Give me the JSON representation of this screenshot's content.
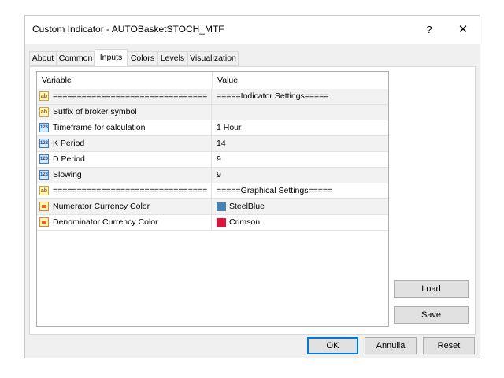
{
  "window": {
    "title": "Custom Indicator - AUTOBasketSTOCH_MTF",
    "help_label": "?",
    "close_label": "✕"
  },
  "tabs": [
    {
      "label": "About",
      "active": false
    },
    {
      "label": "Common",
      "active": false
    },
    {
      "label": "Inputs",
      "active": true
    },
    {
      "label": "Colors",
      "active": false
    },
    {
      "label": "Levels",
      "active": false
    },
    {
      "label": "Visualization",
      "active": false
    }
  ],
  "grid": {
    "headers": {
      "variable": "Variable",
      "value": "Value"
    },
    "rows": [
      {
        "icon": "string-icon",
        "variable": "================================",
        "value": "=====Indicator Settings====="
      },
      {
        "icon": "string-icon",
        "variable": "Suffix of broker symbol",
        "value": ""
      },
      {
        "icon": "integer-icon",
        "variable": "Timeframe for calculation",
        "value": "1 Hour"
      },
      {
        "icon": "integer-icon",
        "variable": "K Period",
        "value": "14"
      },
      {
        "icon": "integer-icon",
        "variable": "D Period",
        "value": "9"
      },
      {
        "icon": "integer-icon",
        "variable": "Slowing",
        "value": "9"
      },
      {
        "icon": "string-icon",
        "variable": "================================",
        "value": "=====Graphical Settings====="
      },
      {
        "icon": "color-icon",
        "variable": "Numerator Currency Color",
        "value": "SteelBlue",
        "swatch": "#4682b4"
      },
      {
        "icon": "color-icon",
        "variable": "Denominator Currency Color",
        "value": "Crimson",
        "swatch": "#dc143c"
      }
    ]
  },
  "side_buttons": {
    "load": "Load",
    "save": "Save"
  },
  "footer_buttons": {
    "ok": "OK",
    "cancel": "Annulla",
    "reset": "Reset"
  }
}
